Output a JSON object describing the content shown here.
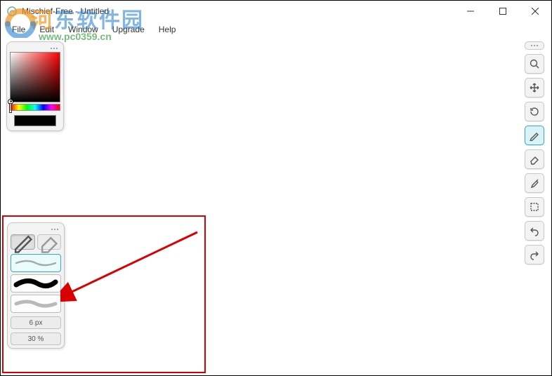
{
  "window": {
    "title": "Mischief-Free - Untitled"
  },
  "menu": {
    "file": "File",
    "edit": "Edit",
    "window": "Window",
    "upgrade": "Upgrade",
    "help": "Help"
  },
  "brush_panel": {
    "size": "6 px",
    "opacity": "30 %"
  },
  "tools": {
    "zoom": "zoom",
    "pan": "pan",
    "rotate": "rotate",
    "brush": "brush",
    "eraser": "eraser",
    "eyedropper": "eyedropper",
    "selection": "selection",
    "undo": "undo",
    "redo": "redo"
  },
  "watermark": {
    "text_cn": "河东软件园",
    "url": "www.pc0359.cn"
  },
  "colors": {
    "swatch": "#000000"
  }
}
